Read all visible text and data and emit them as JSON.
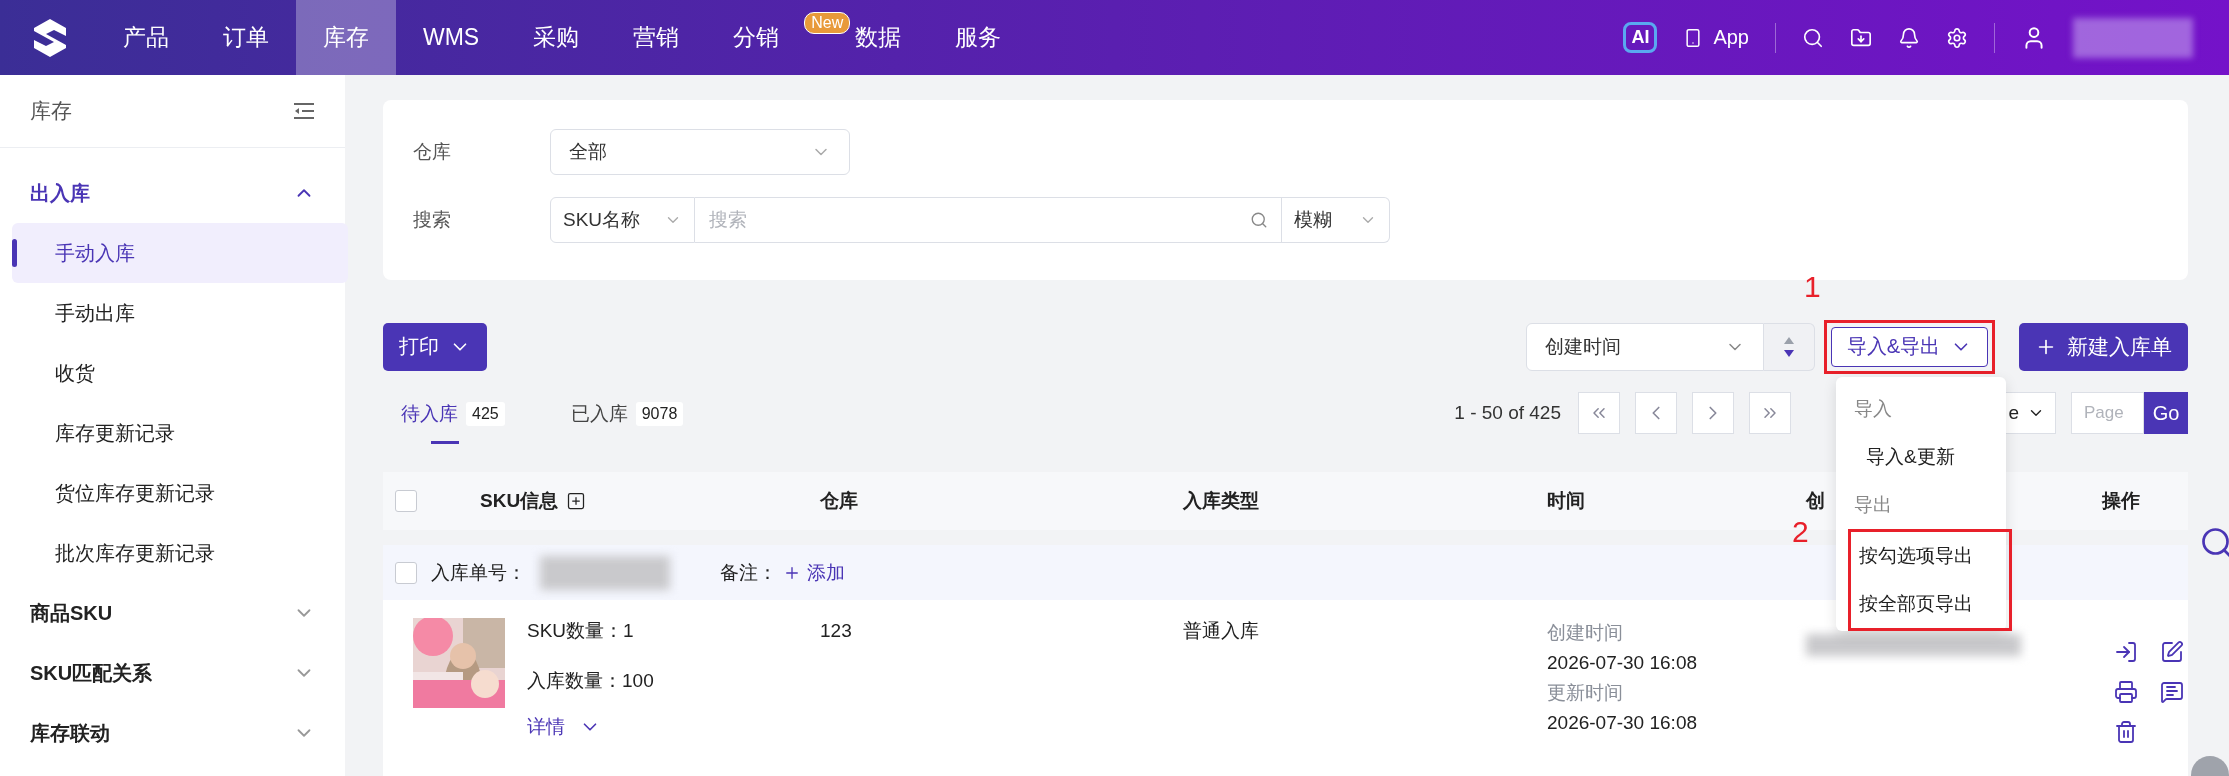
{
  "top_nav": {
    "items": [
      {
        "label": "产品",
        "selected": false
      },
      {
        "label": "订单",
        "selected": false
      },
      {
        "label": "库存",
        "selected": true
      },
      {
        "label": "WMS",
        "selected": false
      },
      {
        "label": "采购",
        "selected": false
      },
      {
        "label": "营销",
        "selected": false
      },
      {
        "label": "分销",
        "selected": false,
        "badge": "New"
      },
      {
        "label": "数据",
        "selected": false
      },
      {
        "label": "服务",
        "selected": false
      }
    ],
    "ai_badge": "AI",
    "app_link": "App"
  },
  "sidebar": {
    "title": "库存",
    "groups": [
      {
        "label": "出入库",
        "expanded": true,
        "children": [
          {
            "label": "手动入库",
            "selected": true
          },
          {
            "label": "手动出库",
            "selected": false
          },
          {
            "label": "收货",
            "selected": false
          },
          {
            "label": "库存更新记录",
            "selected": false
          },
          {
            "label": "货位库存更新记录",
            "selected": false
          },
          {
            "label": "批次库存更新记录",
            "selected": false
          }
        ]
      },
      {
        "label": "商品SKU",
        "expanded": false
      },
      {
        "label": "SKU匹配关系",
        "expanded": false
      },
      {
        "label": "库存联动",
        "expanded": false
      }
    ]
  },
  "filters": {
    "warehouse": {
      "label": "仓库",
      "value": "全部"
    },
    "search": {
      "label": "搜索",
      "field": "SKU名称",
      "placeholder": "搜索",
      "mode": "模糊"
    }
  },
  "toolbar": {
    "print_button": "打印",
    "sort": {
      "value": "创建时间"
    },
    "import_export_button": "导入&导出",
    "new_button": "新建入库单",
    "menu": [
      {
        "kind": "header",
        "label": "导入"
      },
      {
        "kind": "item",
        "label": "导入&更新"
      },
      {
        "kind": "header",
        "label": "导出"
      },
      {
        "kind": "item",
        "label": "按勾选项导出",
        "highlighted": true
      },
      {
        "kind": "item",
        "label": "按全部页导出",
        "highlighted": true
      }
    ]
  },
  "tabs": [
    {
      "label": "待入库",
      "count": "425",
      "selected": true
    },
    {
      "label": "已入库",
      "count": "9078",
      "selected": false
    }
  ],
  "pagination": {
    "range": "1 - 50 of 425",
    "per_page_visible": "e",
    "page_placeholder": "Page",
    "go": "Go"
  },
  "table": {
    "header_checked": false,
    "columns": [
      "SKU信息",
      "仓库",
      "入库类型",
      "时间",
      "创",
      "操作"
    ],
    "orders": [
      {
        "checked": false,
        "order_no_label": "入库单号：",
        "remark_label": "备注：",
        "add_remark": "添加",
        "items": [
          {
            "sku_count": "SKU数量：1",
            "quantity": "入库数量：100",
            "details": "详情",
            "warehouse": "123",
            "type": "普通入库",
            "created_label": "创建时间",
            "created": "2026-07-30 16:08",
            "updated_label": "更新时间",
            "updated": "2026-07-30 16:08"
          }
        ]
      }
    ]
  },
  "annotations": [
    {
      "label": "1"
    },
    {
      "label": "2"
    }
  ]
}
